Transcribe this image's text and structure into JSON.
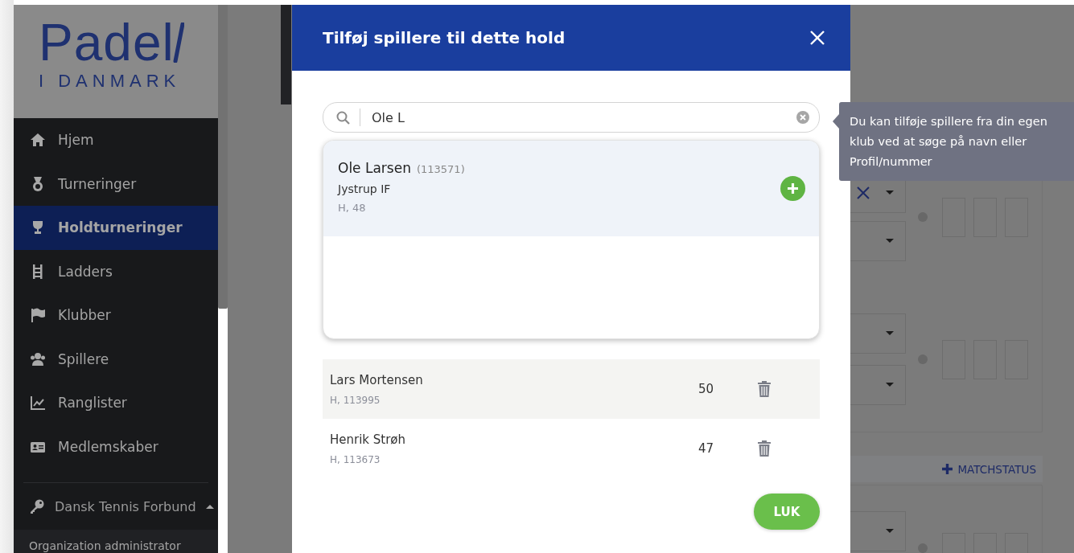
{
  "logo": {
    "wordmark": "Padel",
    "tagline": "I DANMARK"
  },
  "sidebar": {
    "items": [
      {
        "label": "Hjem",
        "selected": false
      },
      {
        "label": "Turneringer",
        "selected": false
      },
      {
        "label": "Holdturneringer",
        "selected": true
      },
      {
        "label": "Ladders",
        "selected": false
      },
      {
        "label": "Klubber",
        "selected": false
      },
      {
        "label": "Spillere",
        "selected": false
      },
      {
        "label": "Ranglister",
        "selected": false
      },
      {
        "label": "Medlemskaber",
        "selected": false
      }
    ],
    "organization": {
      "label": "Dansk Tennis Forbund",
      "expanded": true
    },
    "role": "Organization administrator"
  },
  "background_page": {
    "match_groups": [
      {
        "selects": [
          {
            "kind": "x"
          },
          {
            "kind": "empty"
          }
        ]
      },
      {
        "selects": [
          {
            "kind": "empty"
          },
          {
            "kind": "empty"
          }
        ]
      }
    ],
    "matchstatus_button": "MATCHSTATUS",
    "lower_group": {
      "selects": [
        {
          "kind": "empty"
        }
      ]
    }
  },
  "modal": {
    "title": "Tilføj spillere til dette hold",
    "search": {
      "value": "Ole L"
    },
    "results": [
      {
        "name": "Ole Larsen",
        "number": "(113571)",
        "club": "Jystrup IF",
        "meta": "H, 48",
        "selected": true
      }
    ],
    "players": [
      {
        "name": "Lars Mortensen",
        "meta": "H, 113995",
        "points": "50",
        "striped": true
      },
      {
        "name": "Henrik Strøh",
        "meta": "H, 113673",
        "points": "47",
        "striped": false
      }
    ],
    "close_button": "LUK"
  },
  "tooltip": "Du kan tilføje spillere fra din egen klub ved at søge på navn eller Profil/nummer"
}
